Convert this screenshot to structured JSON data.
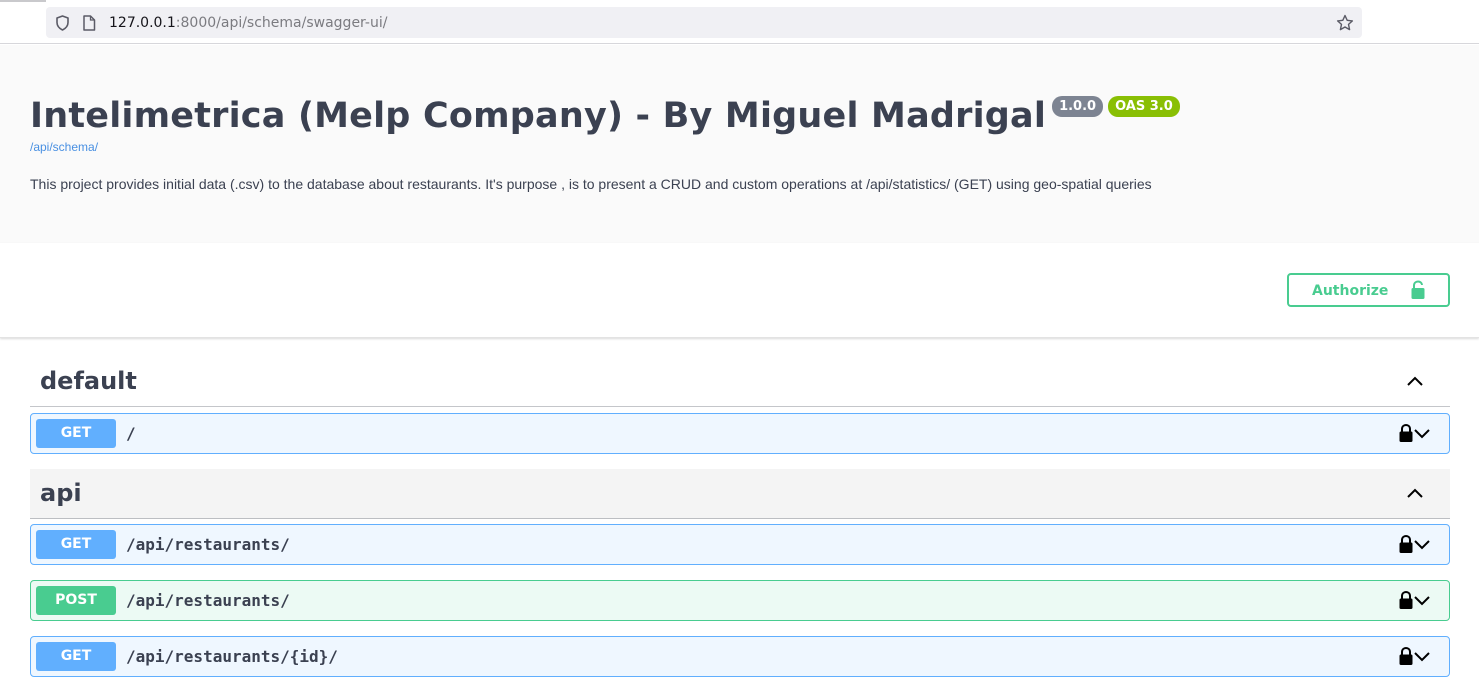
{
  "browser": {
    "url_host": "127.0.0.1",
    "url_rest": ":8000/api/schema/swagger-ui/"
  },
  "info": {
    "title": "Intelimetrica (Melp Company) - By Miguel Madrigal",
    "version": "1.0.0",
    "oas": "OAS 3.0",
    "schema_link": "/api/schema/",
    "description": "This project provides initial data (.csv) to the database about restaurants. It's purpose , is to present a CRUD and custom operations at /api/statistics/ (GET) using geo-spatial queries"
  },
  "auth": {
    "authorize_label": "Authorize"
  },
  "tags": [
    {
      "name": "default",
      "operations": [
        {
          "method": "GET",
          "path": "/"
        }
      ]
    },
    {
      "name": "api",
      "operations": [
        {
          "method": "GET",
          "path": "/api/restaurants/"
        },
        {
          "method": "POST",
          "path": "/api/restaurants/"
        },
        {
          "method": "GET",
          "path": "/api/restaurants/{id}/"
        }
      ]
    }
  ],
  "colors": {
    "get": "#61affe",
    "post": "#49cc90",
    "text": "#3b4151",
    "link": "#4990e2",
    "oas_badge": "#89bf04",
    "version_badge": "#7d8492"
  },
  "icons": {
    "url_bar": [
      "shield-icon",
      "page-icon",
      "star-icon"
    ],
    "authorize": "unlocked-lock-icon",
    "operation": [
      "lock-icon",
      "chevron-down-icon"
    ],
    "tag": "chevron-up-icon"
  }
}
